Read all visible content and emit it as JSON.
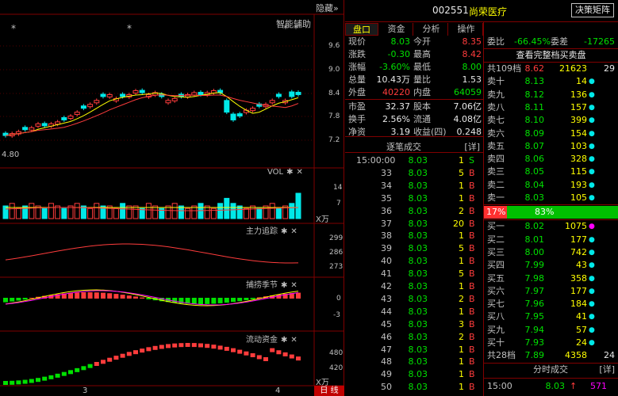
{
  "chart": {
    "hide_label": "隐藏",
    "hide_icon": "double-chevron-right-icon",
    "indicator_label": "智能辅助",
    "price_ticks": [
      "9.6",
      "9.0",
      "8.4",
      "7.8",
      "7.2"
    ],
    "low_label": "4.80",
    "vol_panel": {
      "title": "VOL",
      "ticks": [
        "14",
        "7"
      ],
      "unit": "X万"
    },
    "zl_panel": {
      "title": "主力追踪",
      "ticks": [
        "299",
        "286",
        "273"
      ]
    },
    "bl_panel": {
      "title": "捕捞季节",
      "ticks": [
        "0",
        "-3"
      ]
    },
    "ld_panel": {
      "title": "流动资金",
      "ticks": [
        "480",
        "420"
      ],
      "unit": "X万"
    },
    "x_labels": [
      "3",
      "4"
    ],
    "period_label": "日 线",
    "icons": [
      "settings-icon",
      "close-icon"
    ]
  },
  "header": {
    "code": "002551",
    "name": "尚荣医疗",
    "button": "决策矩阵"
  },
  "tabs": [
    "盘口",
    "资金",
    "分析",
    "操作"
  ],
  "quote": {
    "rows": [
      {
        "l1": "现价",
        "v1": "8.03",
        "c1": "green",
        "l2": "今开",
        "v2": "8.35",
        "c2": "red"
      },
      {
        "l1": "涨跌",
        "v1": "-0.30",
        "c1": "green",
        "l2": "最高",
        "v2": "8.42",
        "c2": "red"
      },
      {
        "l1": "涨幅",
        "v1": "-3.60%",
        "c1": "green",
        "l2": "最低",
        "v2": "8.00",
        "c2": "green"
      },
      {
        "l1": "总量",
        "v1": "10.43万",
        "c1": "white",
        "l2": "量比",
        "v2": "1.53",
        "c2": "white"
      },
      {
        "l1": "外盘",
        "v1": "40220",
        "c1": "red",
        "l2": "内盘",
        "v2": "64059",
        "c2": "green"
      },
      {
        "l1": "市盈",
        "v1": "32.37",
        "c1": "white",
        "l2": "股本",
        "v2": "7.06亿",
        "c2": "white"
      },
      {
        "l1": "换手",
        "v1": "2.56%",
        "c1": "white",
        "l2": "流通",
        "v2": "4.08亿",
        "c2": "white"
      },
      {
        "l1": "净资",
        "v1": "3.19",
        "c1": "white",
        "l2": "收益(四)",
        "v2": "0.248",
        "c2": "white"
      }
    ]
  },
  "ticks_header": {
    "title": "逐笔成交",
    "detail": "[详]"
  },
  "ticks": [
    {
      "t": "15:00:00",
      "p": "8.03",
      "v": "1",
      "s": "S"
    },
    {
      "t": "33",
      "p": "8.03",
      "v": "5",
      "s": "B"
    },
    {
      "t": "34",
      "p": "8.03",
      "v": "1",
      "s": "B"
    },
    {
      "t": "35",
      "p": "8.03",
      "v": "1",
      "s": "B"
    },
    {
      "t": "36",
      "p": "8.03",
      "v": "2",
      "s": "B"
    },
    {
      "t": "37",
      "p": "8.03",
      "v": "20",
      "s": "B"
    },
    {
      "t": "38",
      "p": "8.03",
      "v": "1",
      "s": "B"
    },
    {
      "t": "39",
      "p": "8.03",
      "v": "5",
      "s": "B"
    },
    {
      "t": "40",
      "p": "8.03",
      "v": "1",
      "s": "B"
    },
    {
      "t": "41",
      "p": "8.03",
      "v": "5",
      "s": "B"
    },
    {
      "t": "42",
      "p": "8.03",
      "v": "1",
      "s": "B"
    },
    {
      "t": "43",
      "p": "8.03",
      "v": "2",
      "s": "B"
    },
    {
      "t": "44",
      "p": "8.03",
      "v": "1",
      "s": "B"
    },
    {
      "t": "45",
      "p": "8.03",
      "v": "3",
      "s": "B"
    },
    {
      "t": "46",
      "p": "8.03",
      "v": "2",
      "s": "B"
    },
    {
      "t": "47",
      "p": "8.03",
      "v": "1",
      "s": "B"
    },
    {
      "t": "48",
      "p": "8.03",
      "v": "1",
      "s": "B"
    },
    {
      "t": "49",
      "p": "8.03",
      "v": "1",
      "s": "B"
    },
    {
      "t": "50",
      "p": "8.03",
      "v": "1",
      "s": "B"
    }
  ],
  "book": {
    "ratio": {
      "l1": "委比",
      "v1": "-66.45%",
      "l2": "委差",
      "v2": "-17265"
    },
    "title": "查看完整档买卖盘",
    "ask_total": {
      "lb": "共109档",
      "p": "8.62",
      "v": "21623",
      "n": "29"
    },
    "asks": [
      {
        "lb": "卖十",
        "p": "8.13",
        "v": "14",
        "dot": "●",
        "dc": "cyan"
      },
      {
        "lb": "卖九",
        "p": "8.12",
        "v": "136",
        "dot": "●",
        "dc": "cyan"
      },
      {
        "lb": "卖八",
        "p": "8.11",
        "v": "157",
        "dot": "●",
        "dc": "cyan"
      },
      {
        "lb": "卖七",
        "p": "8.10",
        "v": "399",
        "dot": "●",
        "dc": "cyan"
      },
      {
        "lb": "卖六",
        "p": "8.09",
        "v": "154",
        "dot": "●",
        "dc": "cyan"
      },
      {
        "lb": "卖五",
        "p": "8.07",
        "v": "103",
        "dot": "●",
        "dc": "cyan"
      },
      {
        "lb": "卖四",
        "p": "8.06",
        "v": "328",
        "dot": "●",
        "dc": "cyan"
      },
      {
        "lb": "卖三",
        "p": "8.05",
        "v": "115",
        "dot": "●",
        "dc": "cyan"
      },
      {
        "lb": "卖二",
        "p": "8.04",
        "v": "193",
        "dot": "●",
        "dc": "cyan"
      },
      {
        "lb": "卖一",
        "p": "8.03",
        "v": "105",
        "dot": "●",
        "dc": "cyan"
      }
    ],
    "bar": {
      "left": "17%",
      "right": "83%",
      "left_fraction": 0.17
    },
    "bids": [
      {
        "lb": "买一",
        "p": "8.02",
        "v": "1075",
        "dot": "●",
        "dc": "magenta"
      },
      {
        "lb": "买二",
        "p": "8.01",
        "v": "177",
        "dot": "●",
        "dc": "cyan"
      },
      {
        "lb": "买三",
        "p": "8.00",
        "v": "742",
        "dot": "●",
        "dc": "cyan"
      },
      {
        "lb": "买四",
        "p": "7.99",
        "v": "43",
        "dot": "●",
        "dc": "cyan"
      },
      {
        "lb": "买五",
        "p": "7.98",
        "v": "358",
        "dot": "●",
        "dc": "cyan"
      },
      {
        "lb": "买六",
        "p": "7.97",
        "v": "177",
        "dot": "●",
        "dc": "cyan"
      },
      {
        "lb": "买七",
        "p": "7.96",
        "v": "184",
        "dot": "●",
        "dc": "cyan"
      },
      {
        "lb": "买八",
        "p": "7.95",
        "v": "41",
        "dot": "●",
        "dc": "cyan"
      },
      {
        "lb": "买九",
        "p": "7.94",
        "v": "57",
        "dot": "●",
        "dc": "cyan"
      },
      {
        "lb": "买十",
        "p": "7.93",
        "v": "24",
        "dot": "●",
        "dc": "cyan"
      }
    ],
    "bid_total": {
      "lb": "共28档",
      "p": "7.89",
      "v": "4358",
      "n": "24"
    },
    "fs_header": {
      "title": "分时成交",
      "detail": "[详]"
    },
    "fs_row": {
      "t": "15:00",
      "p": "8.03",
      "arrow": "↑",
      "v": "571"
    }
  }
}
